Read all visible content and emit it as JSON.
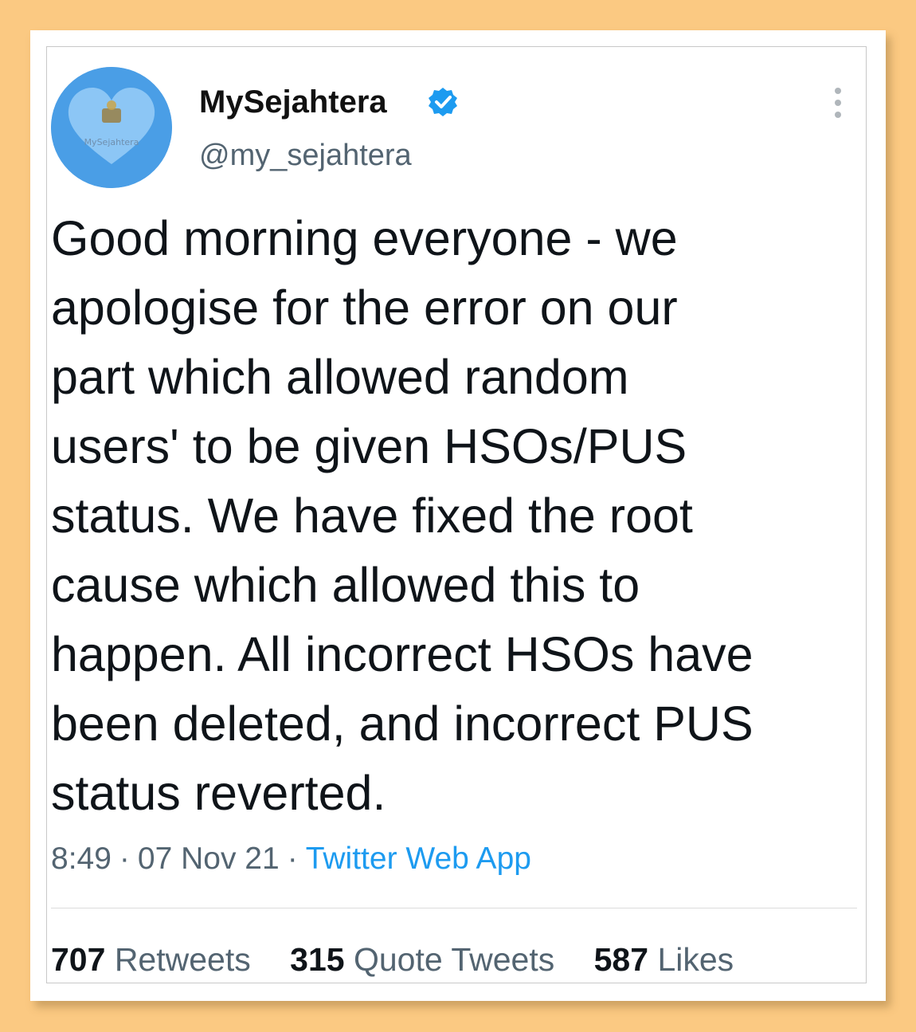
{
  "tweet": {
    "author": {
      "display_name": "MySejahtera",
      "handle": "@my_sejahtera",
      "verified": true,
      "avatar_label": "MySejahtera",
      "avatar_color": "#4a9ee6"
    },
    "text": "Good morning everyone - we\napologise for the error on our\npart which allowed random\nusers' to be given HSOs/PUS\nstatus. We have fixed the root\ncause which allowed this to\nhappen. All incorrect HSOs have\nbeen deleted, and incorrect PUS\nstatus reverted.",
    "time": "8:49",
    "date": "07 Nov 21",
    "separator": "·",
    "source": "Twitter Web App",
    "stats": {
      "retweets_count": "707",
      "retweets_label": "Retweets",
      "quotes_count": "315",
      "quotes_label": "Quote Tweets",
      "likes_count": "587",
      "likes_label": "Likes"
    }
  },
  "icons": {
    "verified": "verified-badge-icon",
    "more": "more-vertical-icon"
  },
  "colors": {
    "page_background": "#fbc982",
    "card_background": "#ffffff",
    "link_blue": "#1d9bf0",
    "muted_gray": "#536471",
    "text_black": "#0f1419"
  }
}
